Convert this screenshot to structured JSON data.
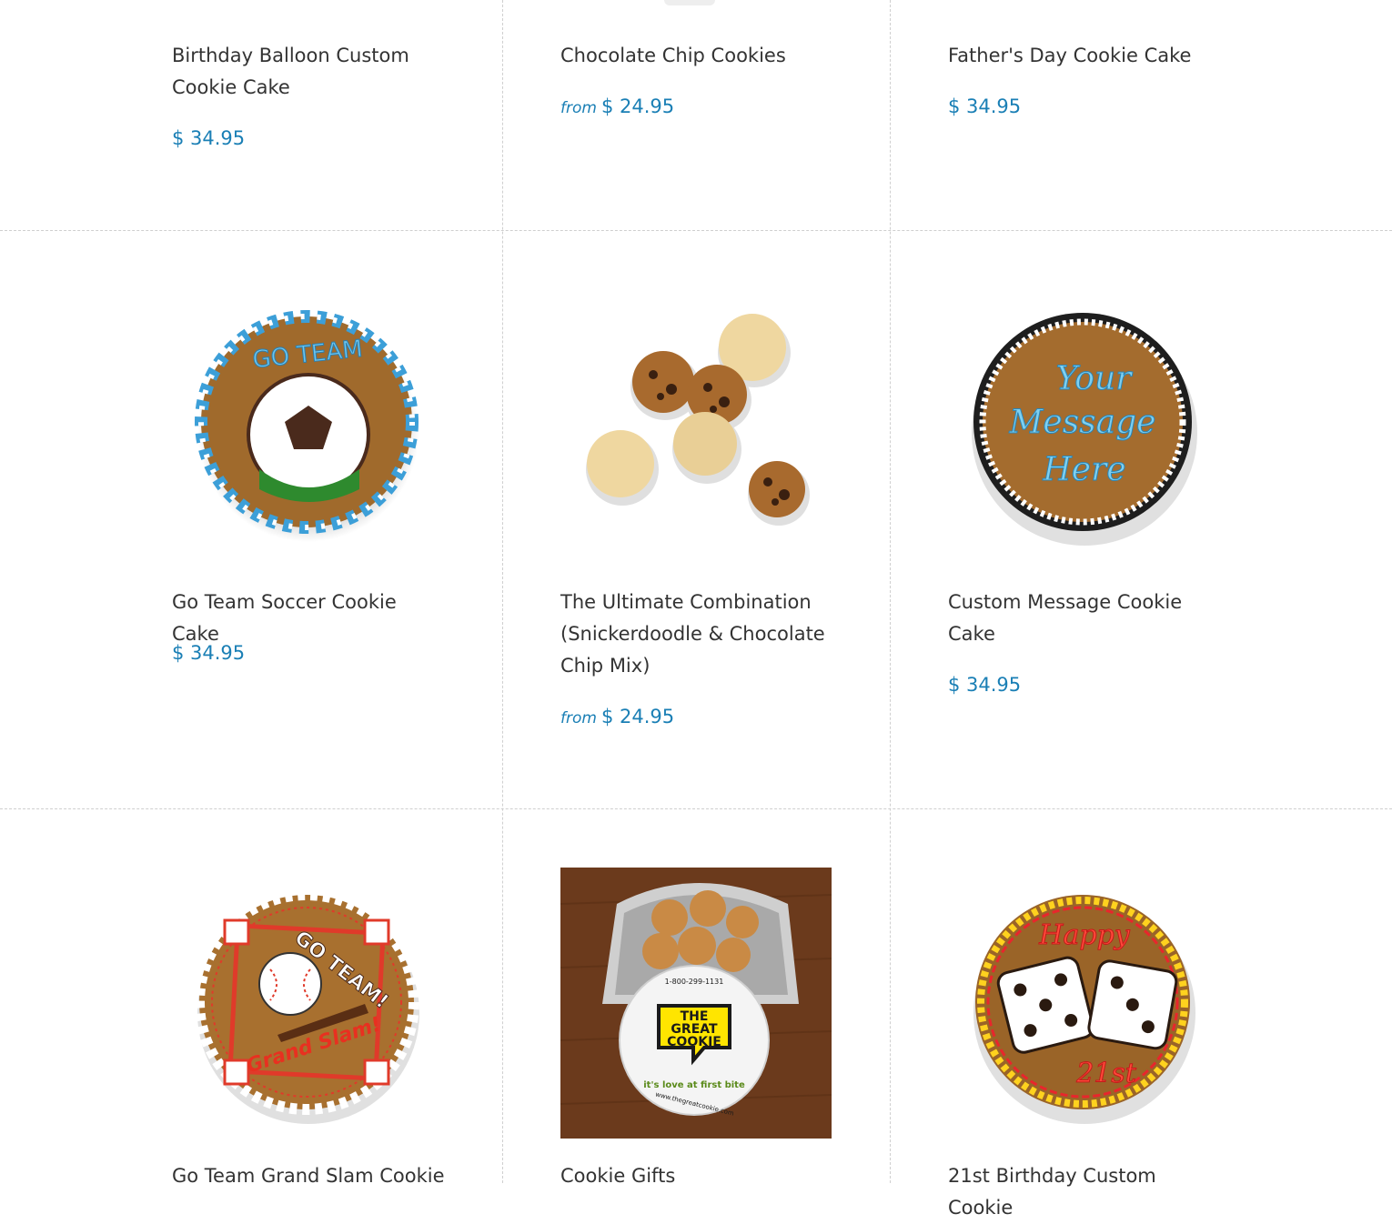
{
  "products": [
    {
      "name": "Birthday Balloon Custom Cookie Cake",
      "price": "$ 34.95",
      "from": ""
    },
    {
      "name": "Chocolate Chip Cookies",
      "price": "$ 24.95",
      "from": "from"
    },
    {
      "name": "Father's Day Cookie Cake",
      "price": "$ 34.95",
      "from": ""
    },
    {
      "name": "Go Team Soccer Cookie Cake",
      "price": "$ 34.95",
      "from": "",
      "image_text": "GO TEAM"
    },
    {
      "name": "The Ultimate Combination (Snickerdoodle & Chocolate Chip Mix)",
      "price": "$ 24.95",
      "from": "from"
    },
    {
      "name": "Custom Message Cookie Cake",
      "price": "$ 34.95",
      "from": "",
      "image_text": [
        "Your",
        "Message",
        "Here"
      ]
    },
    {
      "name": "Go Team Grand Slam Cookie",
      "image_text": [
        "GO TEAM!",
        "Grand Slam!"
      ]
    },
    {
      "name": "Cookie Gifts",
      "image_text": [
        "1-800-299-1131",
        "THE",
        "GREAT",
        "COOKIE",
        "it's love at first bite",
        "www.thegreatcookie.com"
      ]
    },
    {
      "name": "21st Birthday Custom Cookie",
      "image_text": [
        "Happy",
        "21st"
      ]
    }
  ]
}
